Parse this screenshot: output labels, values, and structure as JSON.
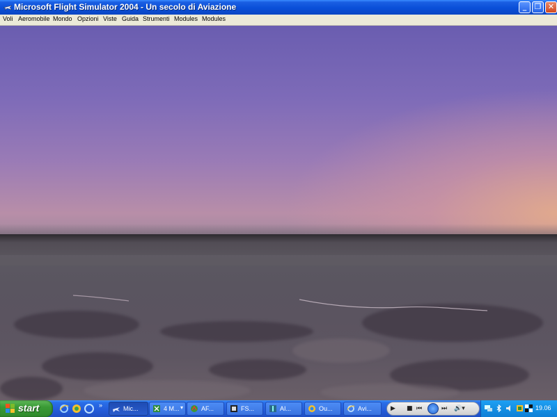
{
  "window": {
    "title": "Microsoft Flight Simulator 2004 - Un secolo di Aviazione",
    "minimize_icon": "minimize-icon",
    "maximize_icon": "restore-icon",
    "close_icon": "close-icon"
  },
  "menubar": {
    "items": [
      "Voli",
      "Aeromobile",
      "Mondo",
      "Opzioni",
      "Viste",
      "Guida",
      "Strumenti",
      "Modules",
      "Modules"
    ]
  },
  "viewport": {
    "scene": "flight-simulator-3d-view",
    "sky_top_color": "#6a5db0",
    "sky_horizon_color": "#e2aa8c",
    "ground_color": "#5a5560"
  },
  "taskbar": {
    "start_label": "start",
    "quick_launch_icons": [
      "internet-explorer-icon",
      "messenger-icon",
      "outlook-icon"
    ],
    "overflow_label": "»",
    "tasks": [
      {
        "label": "Mic...",
        "icon": "flight-simulator-icon",
        "active": true
      },
      {
        "label": "4 M...",
        "icon": "excel-icon",
        "active": false,
        "has_dropdown": true
      },
      {
        "label": "AF...",
        "icon": "adobe-icon",
        "active": false
      },
      {
        "label": "FS...",
        "icon": "fsuipc-icon",
        "active": false
      },
      {
        "label": "AI...",
        "icon": "ai-icon",
        "active": false
      },
      {
        "label": "Ou...",
        "icon": "outlook-icon",
        "active": false
      },
      {
        "label": "Avi...",
        "icon": "internet-explorer-icon",
        "active": false
      }
    ],
    "media_player": {
      "stop": "■",
      "prev": "⏮",
      "next": "⏭",
      "volume": "🔊▾"
    },
    "tray": {
      "icons": [
        "network-icon",
        "bluetooth-icon",
        "speaker-icon",
        "security-icon",
        "antivirus-icon"
      ],
      "clock": "19.06"
    }
  }
}
